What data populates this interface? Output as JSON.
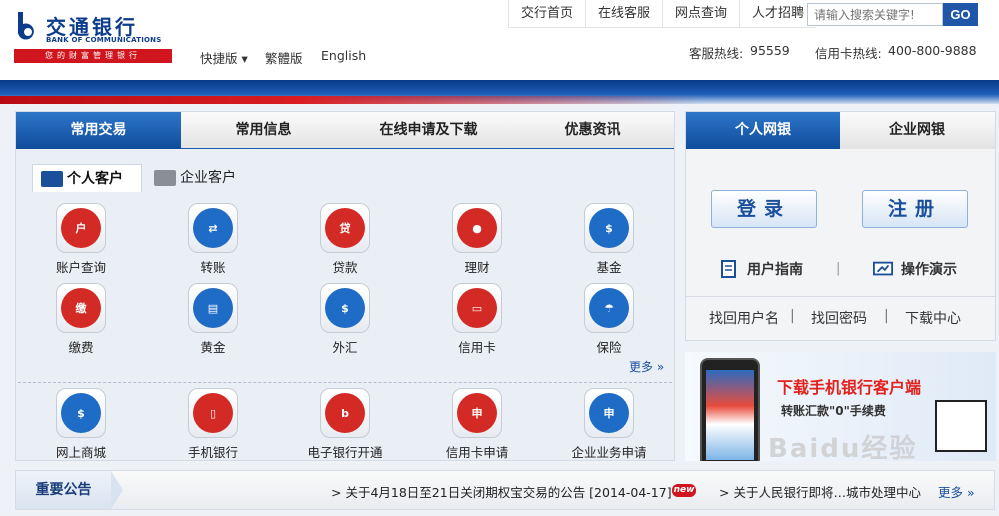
{
  "logo": {
    "cn": "交通银行",
    "en": "BANK OF COMMUNICATIONS",
    "slogan": "您的财富管理银行"
  },
  "version_links": {
    "quick": "快捷版 ▾",
    "traditional": "繁體版",
    "english": "English"
  },
  "top_nav": [
    "交行首页",
    "在线客服",
    "网点查询",
    "人才招聘"
  ],
  "search": {
    "placeholder": "请输入搜索关键字!",
    "button": "GO"
  },
  "hotlines": {
    "service_label": "客服热线:",
    "service_number": "95559",
    "card_label": "信用卡热线:",
    "card_number": "400-800-9888"
  },
  "main_tabs": [
    "常用交易",
    "常用信息",
    "在线申请及下载",
    "优惠资讯"
  ],
  "customer_tabs": [
    "个人客户",
    "企业客户"
  ],
  "personal_items": [
    {
      "label": "账户查询",
      "icon": "account-query-icon",
      "color": "#d42a25",
      "glyph": "户"
    },
    {
      "label": "转账",
      "icon": "transfer-icon",
      "color": "#1f6cc7",
      "glyph": "⇄"
    },
    {
      "label": "贷款",
      "icon": "loan-icon",
      "color": "#d42a25",
      "glyph": "贷"
    },
    {
      "label": "理财",
      "icon": "wealth-icon",
      "color": "#d42a25",
      "glyph": "●"
    },
    {
      "label": "基金",
      "icon": "fund-icon",
      "color": "#1f6cc7",
      "glyph": "$"
    },
    {
      "label": "缴费",
      "icon": "payment-icon",
      "color": "#d42a25",
      "glyph": "缴"
    },
    {
      "label": "黄金",
      "icon": "gold-icon",
      "color": "#1f6cc7",
      "glyph": "▤"
    },
    {
      "label": "外汇",
      "icon": "forex-icon",
      "color": "#1f6cc7",
      "glyph": "$"
    },
    {
      "label": "信用卡",
      "icon": "credit-card-icon",
      "color": "#d42a25",
      "glyph": "▭"
    },
    {
      "label": "保险",
      "icon": "insurance-icon",
      "color": "#1f6cc7",
      "glyph": "☂"
    }
  ],
  "more_label": "更多 »",
  "bottom_items": [
    {
      "label": "网上商城",
      "icon": "online-mall-icon",
      "color": "#1f6cc7",
      "glyph": "$"
    },
    {
      "label": "手机银行",
      "icon": "mobile-banking-icon",
      "color": "#d42a25",
      "glyph": "▯"
    },
    {
      "label": "电子银行开通",
      "icon": "ebank-open-icon",
      "color": "#d42a25",
      "glyph": "b"
    },
    {
      "label": "信用卡申请",
      "icon": "credit-card-apply-icon",
      "color": "#d42a25",
      "glyph": "申"
    },
    {
      "label": "企业业务申请",
      "icon": "enterprise-apply-icon",
      "color": "#1f6cc7",
      "glyph": "申"
    }
  ],
  "right_tabs": [
    "个人网银",
    "企业网银"
  ],
  "right_buttons": {
    "login": "登录",
    "register": "注册"
  },
  "right_guides": {
    "guide": "用户指南",
    "demo": "操作演示"
  },
  "right_links": [
    "找回用户名",
    "找回密码",
    "下载中心"
  ],
  "promo": {
    "title": "下载手机银行客户端",
    "subtitle": "转账汇款\"0\"手续费"
  },
  "notice": {
    "label": "重要公告",
    "item1": "> 关于4月18日至21日关闭期权宝交易的公告 [2014-04-17]",
    "new_badge": "new",
    "item2": "> 关于人民银行即将…城市处理中心",
    "more": "更多 »"
  },
  "watermark": "Baidu经验",
  "colors": {
    "brand_blue": "#0d3c8c",
    "brand_red": "#d0151e",
    "tab_active": "#1f5fb0"
  }
}
